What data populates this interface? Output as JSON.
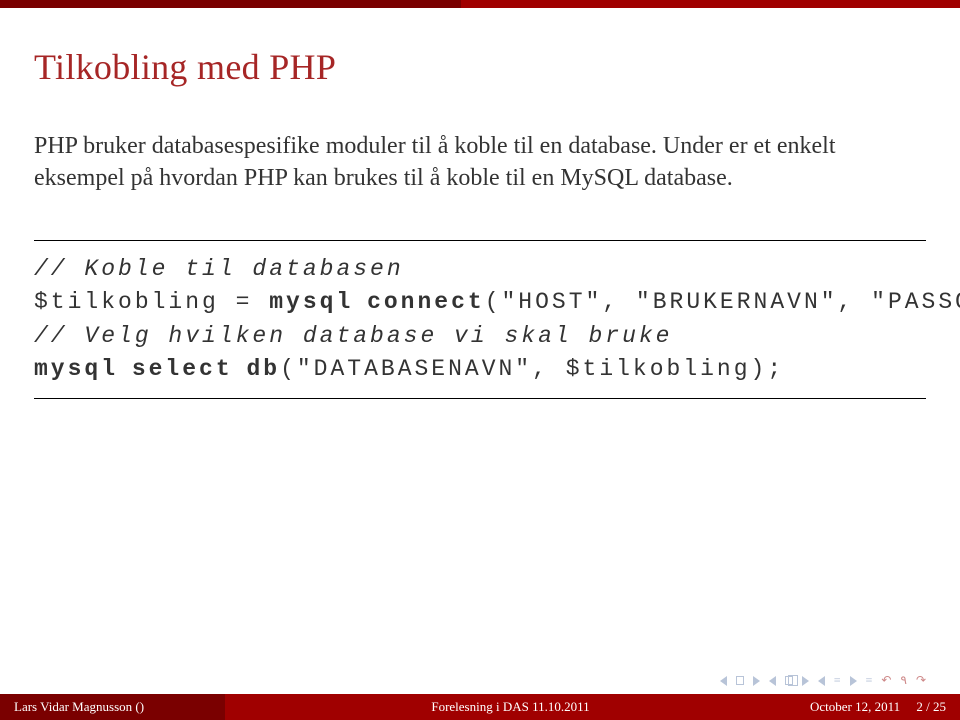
{
  "title": "Tilkobling med PHP",
  "paragraph": "PHP bruker databasespesifike moduler til å koble til en database. Under er et enkelt eksempel på hvordan PHP kan brukes til å koble til en MySQL database.",
  "code": {
    "line1_comment": "// Koble til databasen",
    "line2_var": "$tilkobling",
    "line2_eq": " = ",
    "line2_fn": "mysql",
    "line2_fn2": "connect",
    "line2_args": "(\"HOST\", \"BRUKERNAVN\", \"PASSORD\"",
    "line3_comment": "// Velg hvilken database vi skal bruke",
    "line4_fn": "mysql",
    "line4_fn2": "select",
    "line4_fn3": "db",
    "line4_args": "(\"DATABASENAVN\", $tilkobling);"
  },
  "footer": {
    "author": "Lars Vidar Magnusson ()",
    "center": "Forelesning i DAS 11.10.2011",
    "date": "October 12, 2011",
    "page": "2 / 25"
  }
}
